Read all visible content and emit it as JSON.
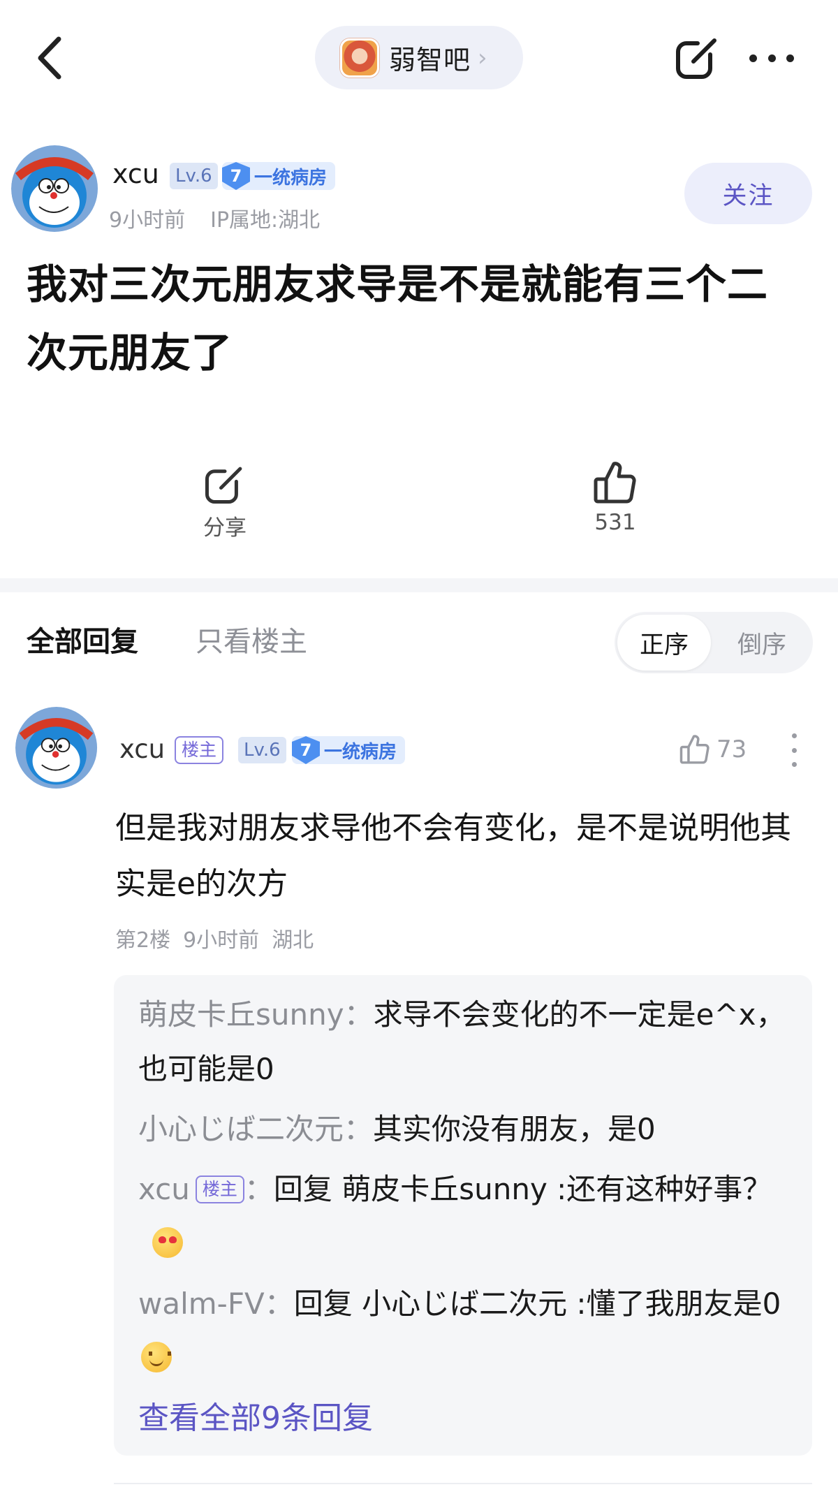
{
  "topbar": {
    "forum_name": "弱智吧",
    "forum_chevron": "›",
    "icons": [
      "back-icon",
      "forum-avatar",
      "share-icon",
      "more-icon"
    ]
  },
  "post": {
    "author": "xcu",
    "level": "Lv.6",
    "rank_number": "7",
    "rank_name": "一统病房",
    "time": "9小时前",
    "ip": "IP属地:湖北",
    "follow_label": "关注",
    "title": "我对三次元朋友求导是不是就能有三个二次元朋友了",
    "share_label": "分享",
    "like_count": "531"
  },
  "reply_tabs": {
    "all": "全部回复",
    "op_only": "只看楼主",
    "sort_asc": "正序",
    "sort_desc": "倒序"
  },
  "reply": {
    "author": "xcu",
    "op_tag": "楼主",
    "level": "Lv.6",
    "rank_number": "7",
    "rank_name": "一统病房",
    "like_count": "73",
    "content": "但是我对朋友求导他不会有变化，是不是说明他其实是e的次方",
    "floor": "第2楼",
    "time": "9小时前",
    "location": "湖北",
    "sub_replies": [
      {
        "author": "萌皮卡丘sunny",
        "sep": "：",
        "text": "求导不会变化的不一定是e^x，也可能是0"
      },
      {
        "author": "小心じば二次元",
        "sep": "：",
        "text": "其实你没有朋友，是0"
      },
      {
        "author": "xcu",
        "op_tag": "楼主",
        "sep": "：",
        "text": "回复 萌皮卡丘sunny :还有这种好事？",
        "emoji": "heart-eyes-emoji"
      },
      {
        "author": "walm-FV",
        "sep": "：",
        "text": "回复 小心じば二次元 :懂了我朋友是0",
        "emoji": "smile-emoji"
      }
    ],
    "view_all": "查看全部9条回复"
  },
  "colors": {
    "accent": "#5b55c4",
    "muted_text": "#9a9ca3",
    "level_badge_bg": "#dde6f6",
    "rank_badge_blue": "#4d8ff0"
  }
}
